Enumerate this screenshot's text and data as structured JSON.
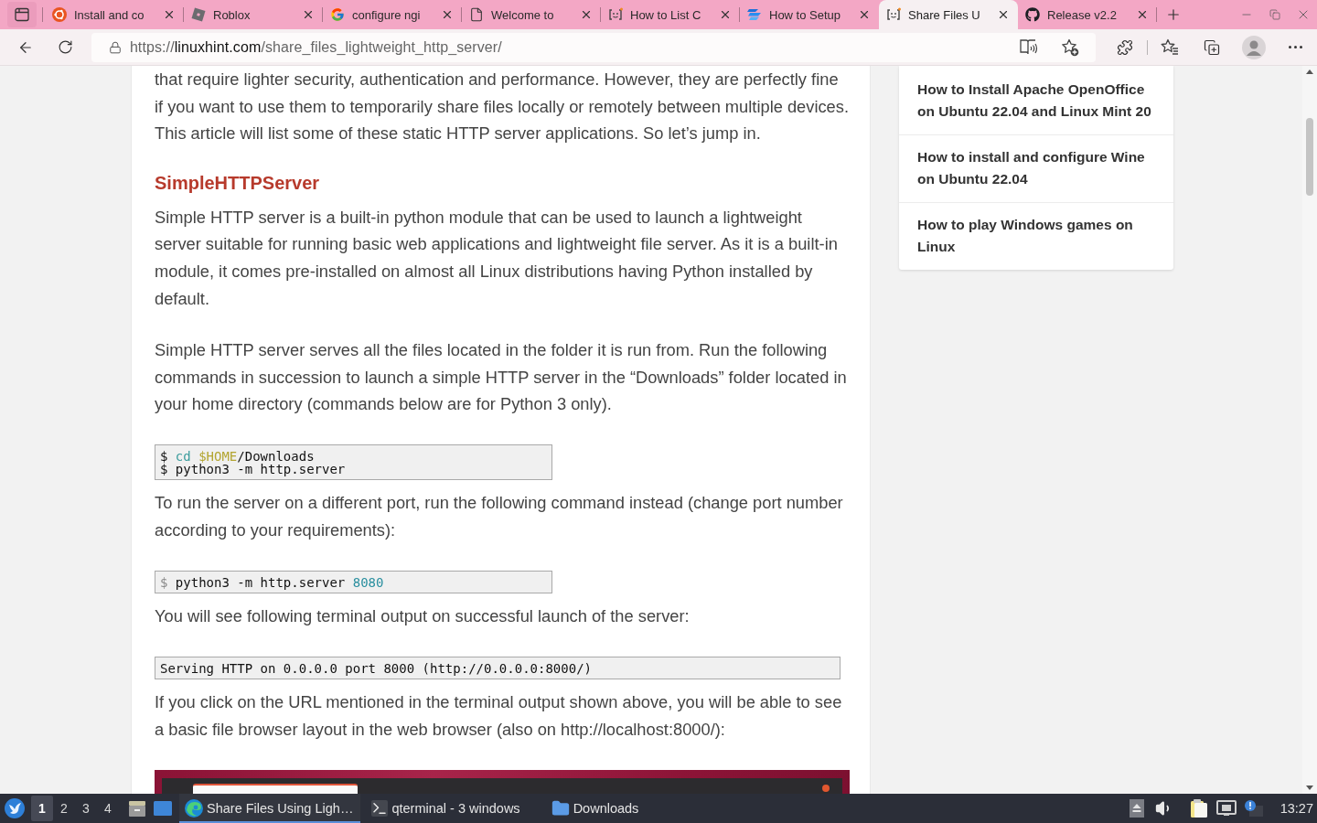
{
  "browser": {
    "tabs": [
      {
        "title": "Install and co",
        "selected": false
      },
      {
        "title": "Roblox",
        "selected": false
      },
      {
        "title": "configure ngi",
        "selected": false
      },
      {
        "title": "Welcome to",
        "selected": false
      },
      {
        "title": "How to List C",
        "selected": false
      },
      {
        "title": "How to Setup",
        "selected": false
      },
      {
        "title": "Share Files U",
        "selected": true
      },
      {
        "title": "Release v2.2",
        "selected": false
      }
    ],
    "address": {
      "scheme": "https://",
      "host": "linuxhint.com",
      "path": "/share_files_lightweight_http_server/"
    }
  },
  "article": {
    "blocks": [
      {
        "kind": "paragraph",
        "text": "that require lighter security, authentication and performance. However, they are perfectly fine if you want to use them to temporarily share files locally or remotely between multiple devices. This article will list some of these static HTTP server applications. So let’s jump in."
      },
      {
        "kind": "heading",
        "text": "SimpleHTTPServer"
      },
      {
        "kind": "paragraph",
        "text": "Simple HTTP server is a built-in python module that can be used to launch a lightweight server suitable for running basic web applications and lightweight file server. As it is a built-in module, it comes pre-installed on almost all Linux distributions having Python installed by default."
      },
      {
        "kind": "paragraph",
        "text": "Simple HTTP server serves all the files located in the folder it is run from. Run the following commands in succession to launch a simple HTTP server in the “Downloads” folder located in your home directory (commands below are for Python 3 only)."
      },
      {
        "kind": "command",
        "lines": [
          [
            {
              "kind": "plain",
              "text": "$ "
            },
            {
              "kind": "builtin",
              "text": "cd"
            },
            {
              "kind": "variable",
              "text": " $HOME"
            },
            {
              "kind": "plain",
              "text": "/Downloads"
            }
          ],
          [
            {
              "kind": "plain",
              "text": "$ python3 -m http.server"
            }
          ]
        ]
      },
      {
        "kind": "paragraph",
        "text": "To run the server on a different port, run the following command instead (change port number according to your requirements):"
      },
      {
        "kind": "command",
        "lines": [
          [
            {
              "kind": "prompt",
              "text": "$ "
            },
            {
              "kind": "plain",
              "text": "python3 -m http.server "
            },
            {
              "kind": "number",
              "text": "8080"
            }
          ]
        ]
      },
      {
        "kind": "paragraph",
        "text": "You will see following terminal output on successful launch of the server:"
      },
      {
        "kind": "output",
        "lines": [
          [
            {
              "kind": "plain",
              "text": "Serving HTTP on 0.0.0.0 port 8000 (http://0.0.0.0:8000/)"
            }
          ]
        ]
      },
      {
        "kind": "paragraph",
        "text": "If you click on the URL mentioned in the terminal output shown above, you will be able to see a basic file browser layout in the web browser (also on http://localhost:8000/):"
      },
      {
        "kind": "image"
      }
    ]
  },
  "sidebar": {
    "links": [
      {
        "title": "How to Install Apache OpenOffice on Ubuntu 22.04 and Linux Mint 20"
      },
      {
        "title": "How to install and configure Wine on Ubuntu 22.04"
      },
      {
        "title": "How to play Windows games on Linux"
      }
    ]
  },
  "taskbar": {
    "workspaces": [
      {
        "label": "1",
        "selected": true
      },
      {
        "label": "2",
        "selected": false
      },
      {
        "label": "3",
        "selected": false
      },
      {
        "label": "4",
        "selected": false
      }
    ],
    "tasks": [
      {
        "label": "Share Files Using Ligh…",
        "selected": true
      },
      {
        "label": "qterminal - 3 windows",
        "selected": false
      },
      {
        "label": "Downloads",
        "selected": false
      }
    ],
    "clock": "13:27"
  }
}
